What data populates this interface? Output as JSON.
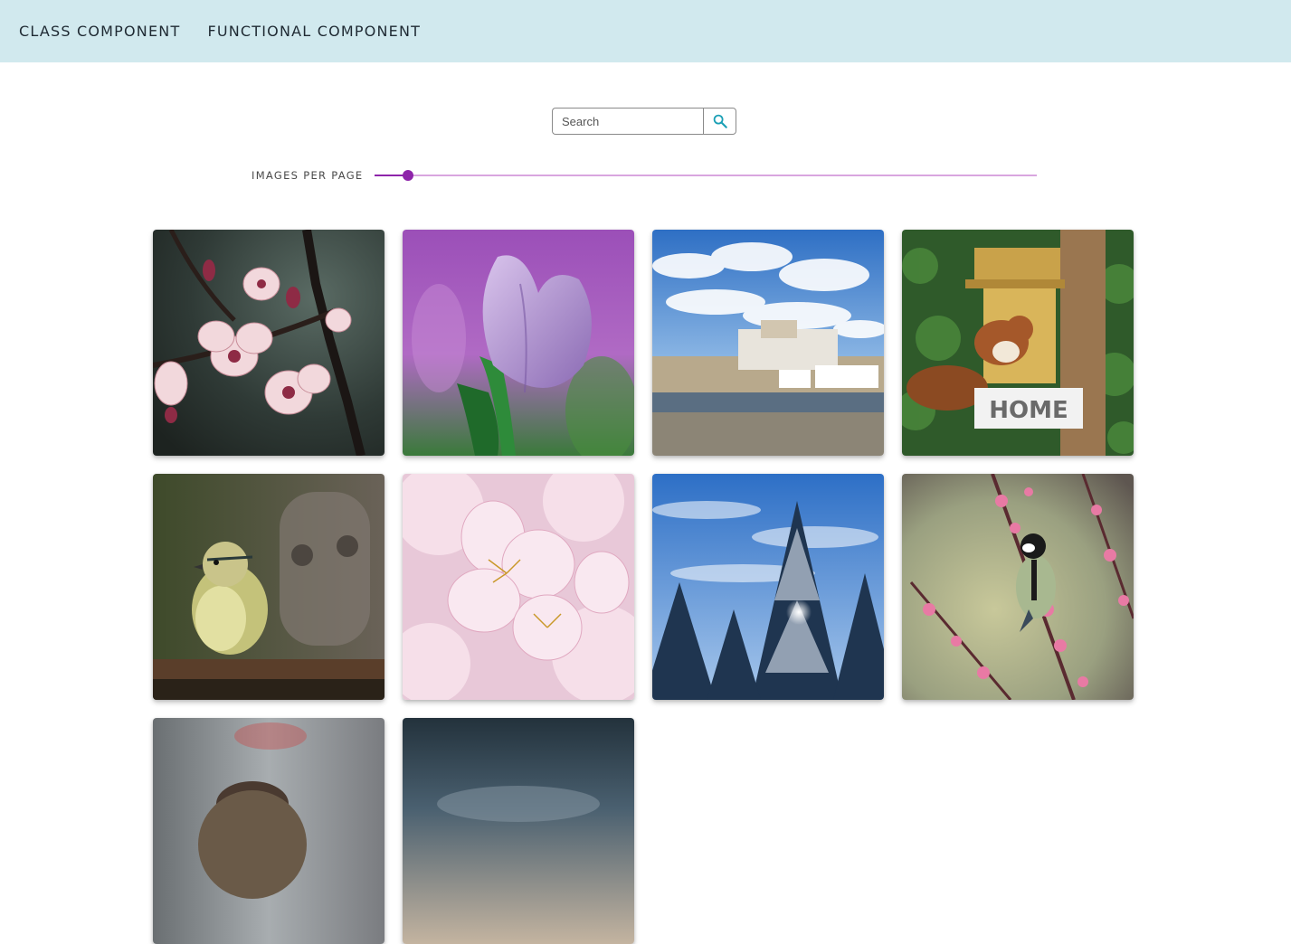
{
  "nav": {
    "class_component": "CLASS COMPONENT",
    "functional_component": "FUNCTIONAL COMPONENT"
  },
  "search": {
    "placeholder": "Search",
    "value": "",
    "button_icon": "search-icon"
  },
  "slider": {
    "label": "IMAGES PER PAGE",
    "fraction": 0.05
  },
  "colors": {
    "topbar": "#d1e9ee",
    "accent": "#8e24aa",
    "search_icon": "#1a9fb5"
  },
  "gallery": {
    "images": [
      {
        "subject": "pink blossom branch"
      },
      {
        "subject": "purple tulip"
      },
      {
        "subject": "coastal castle town"
      },
      {
        "subject": "squirrel on birdhouse"
      },
      {
        "subject": "yellow songbird on branch"
      },
      {
        "subject": "pink cherry blossom closeup"
      },
      {
        "subject": "snowy pine forest"
      },
      {
        "subject": "great tit on blossom branch"
      },
      {
        "subject": "bird portrait"
      },
      {
        "subject": "dusky landscape"
      }
    ]
  }
}
